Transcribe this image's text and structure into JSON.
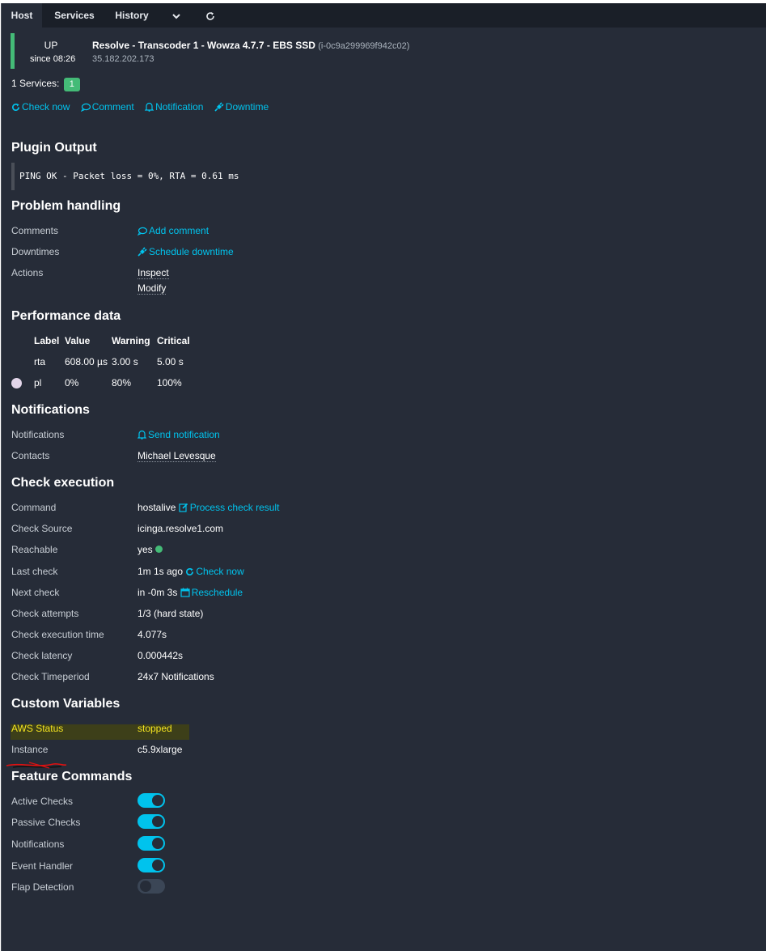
{
  "tabs": {
    "host": "Host",
    "services": "Services",
    "history": "History",
    "more_icon": "chevron-down-icon",
    "refresh_icon": "refresh-icon"
  },
  "host": {
    "state": "UP",
    "since": "since 08:26",
    "name": "Resolve - Transcoder 1 - Wowza 4.7.7 - EBS SSD",
    "instance_id": "(i-0c9a299969f942c02)",
    "address": "35.182.202.173",
    "state_color": "#44bb77"
  },
  "services": {
    "label": "1 Services:",
    "count": "1"
  },
  "quick_actions": {
    "check_now": "Check now",
    "comment": "Comment",
    "notification": "Notification",
    "downtime": "Downtime"
  },
  "plugin_output": {
    "title": "Plugin Output",
    "text": "PING OK - Packet loss = 0%, RTA = 0.61 ms"
  },
  "problem_handling": {
    "title": "Problem handling",
    "comments_label": "Comments",
    "comments_action": "Add comment",
    "downtimes_label": "Downtimes",
    "downtimes_action": "Schedule downtime",
    "actions_label": "Actions",
    "action_inspect": "Inspect",
    "action_modify": "Modify"
  },
  "performance": {
    "title": "Performance data",
    "headers": [
      "Label",
      "Value",
      "Warning",
      "Critical"
    ],
    "rows": [
      {
        "label": "rta",
        "value": "608.00 µs",
        "warning": "3.00 s",
        "critical": "5.00 s"
      },
      {
        "label": "pl",
        "value": "0%",
        "warning": "80%",
        "critical": "100%"
      }
    ]
  },
  "notifications": {
    "title": "Notifications",
    "notifications_label": "Notifications",
    "send_action": "Send notification",
    "contacts_label": "Contacts",
    "contacts_value": "Michael Levesque"
  },
  "check_execution": {
    "title": "Check execution",
    "command_label": "Command",
    "command_value": "hostalive",
    "command_action": "Process check result",
    "source_label": "Check Source",
    "source_value": "icinga.resolve1.com",
    "reachable_label": "Reachable",
    "reachable_value": "yes",
    "last_label": "Last check",
    "last_value": "1m 1s ago",
    "last_action": "Check now",
    "next_label": "Next check",
    "next_value": "in -0m 3s",
    "next_action": "Reschedule",
    "attempts_label": "Check attempts",
    "attempts_value": "1/3 (hard state)",
    "exec_time_label": "Check execution time",
    "exec_time_value": "4.077s",
    "latency_label": "Check latency",
    "latency_value": "0.000442s",
    "timeperiod_label": "Check Timeperiod",
    "timeperiod_value": "24x7 Notifications"
  },
  "custom_variables": {
    "title": "Custom Variables",
    "aws_status_label": "AWS Status",
    "aws_status_value": "stopped",
    "instance_label": "Instance",
    "instance_value": "c5.9xlarge"
  },
  "feature_commands": {
    "title": "Feature Commands",
    "items": [
      {
        "label": "Active Checks",
        "enabled": true
      },
      {
        "label": "Passive Checks",
        "enabled": true
      },
      {
        "label": "Notifications",
        "enabled": true
      },
      {
        "label": "Event Handler",
        "enabled": true
      },
      {
        "label": "Flap Detection",
        "enabled": false
      }
    ]
  },
  "colors": {
    "background": "#262c38",
    "accent": "#00c3ed",
    "ok": "#44bb77",
    "highlight_text": "#f5e520"
  }
}
